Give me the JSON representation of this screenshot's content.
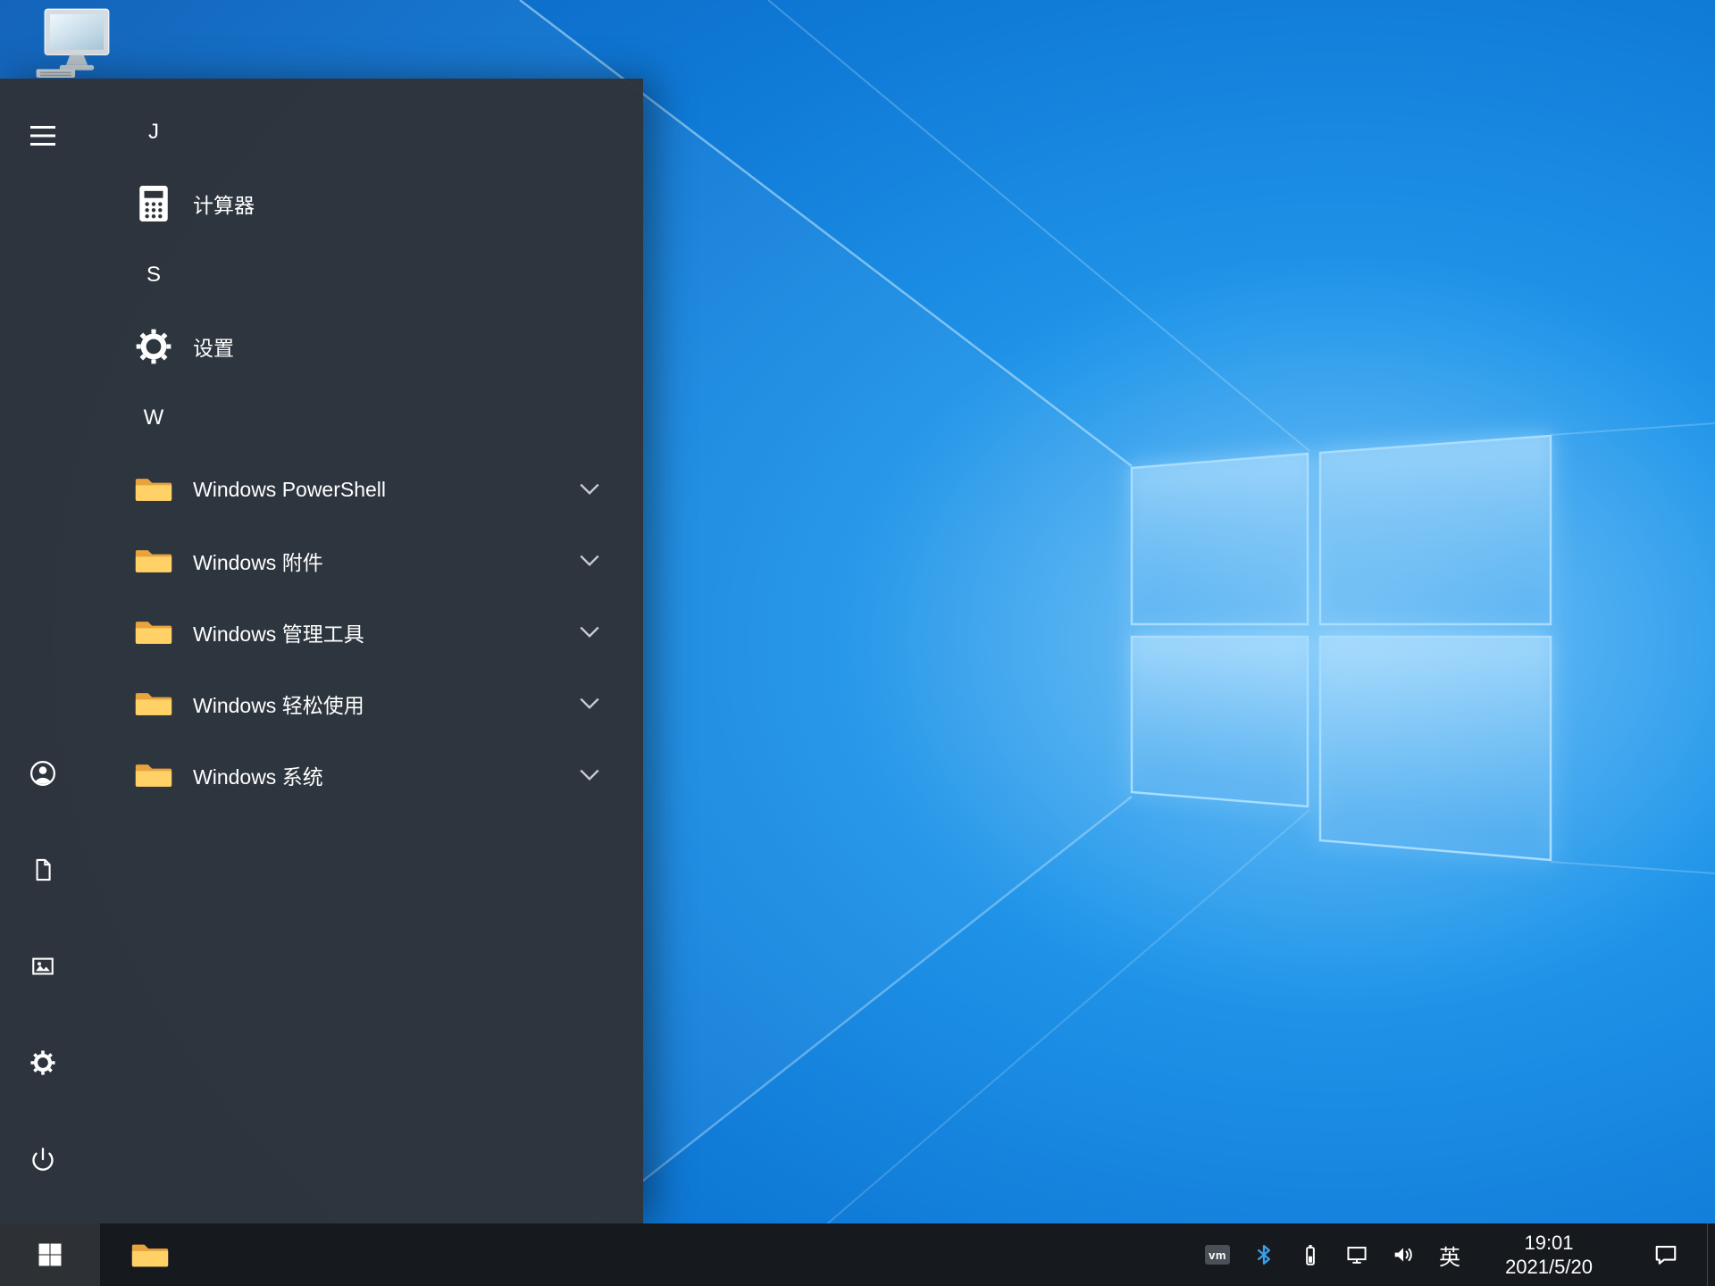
{
  "colors": {
    "wallpaper_blue": "#1e8fe6",
    "menu_bg": "#2e333a",
    "taskbar_bg": "#16191d",
    "folder_yellow": "#ffd167",
    "bluetooth_blue": "#3aa0e8"
  },
  "desktop": {
    "icons": [
      {
        "name": "this-pc"
      }
    ]
  },
  "start_menu": {
    "sections": [
      {
        "header": "J",
        "items": [
          {
            "label": "计算器",
            "icon": "calculator-icon",
            "has_submenu": false
          }
        ]
      },
      {
        "header": "S",
        "items": [
          {
            "label": "设置",
            "icon": "gear-icon",
            "has_submenu": false
          }
        ]
      },
      {
        "header": "W",
        "items": [
          {
            "label": "Windows PowerShell",
            "icon": "folder-icon",
            "has_submenu": true
          },
          {
            "label": "Windows 附件",
            "icon": "folder-icon",
            "has_submenu": true
          },
          {
            "label": "Windows 管理工具",
            "icon": "folder-icon",
            "has_submenu": true
          },
          {
            "label": "Windows 轻松使用",
            "icon": "folder-icon",
            "has_submenu": true
          },
          {
            "label": "Windows 系统",
            "icon": "folder-icon",
            "has_submenu": true
          }
        ]
      }
    ],
    "rail_items": [
      "expand-menu",
      "user-account",
      "documents",
      "pictures",
      "settings",
      "power"
    ]
  },
  "taskbar": {
    "tray": {
      "vmware_label": "vm",
      "input_language": "英",
      "time": "19:01",
      "date": "2021/5/20"
    }
  }
}
